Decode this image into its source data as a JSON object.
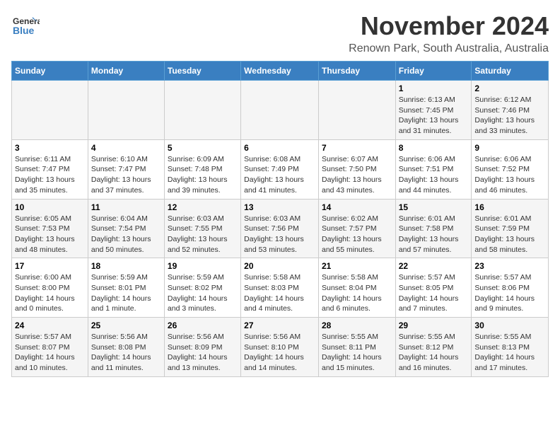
{
  "header": {
    "logo_line1": "General",
    "logo_line2": "Blue",
    "title": "November 2024",
    "subtitle": "Renown Park, South Australia, Australia"
  },
  "days_of_week": [
    "Sunday",
    "Monday",
    "Tuesday",
    "Wednesday",
    "Thursday",
    "Friday",
    "Saturday"
  ],
  "weeks": [
    [
      {
        "day": "",
        "content": ""
      },
      {
        "day": "",
        "content": ""
      },
      {
        "day": "",
        "content": ""
      },
      {
        "day": "",
        "content": ""
      },
      {
        "day": "",
        "content": ""
      },
      {
        "day": "1",
        "content": "Sunrise: 6:13 AM\nSunset: 7:45 PM\nDaylight: 13 hours and 31 minutes."
      },
      {
        "day": "2",
        "content": "Sunrise: 6:12 AM\nSunset: 7:46 PM\nDaylight: 13 hours and 33 minutes."
      }
    ],
    [
      {
        "day": "3",
        "content": "Sunrise: 6:11 AM\nSunset: 7:47 PM\nDaylight: 13 hours and 35 minutes."
      },
      {
        "day": "4",
        "content": "Sunrise: 6:10 AM\nSunset: 7:47 PM\nDaylight: 13 hours and 37 minutes."
      },
      {
        "day": "5",
        "content": "Sunrise: 6:09 AM\nSunset: 7:48 PM\nDaylight: 13 hours and 39 minutes."
      },
      {
        "day": "6",
        "content": "Sunrise: 6:08 AM\nSunset: 7:49 PM\nDaylight: 13 hours and 41 minutes."
      },
      {
        "day": "7",
        "content": "Sunrise: 6:07 AM\nSunset: 7:50 PM\nDaylight: 13 hours and 43 minutes."
      },
      {
        "day": "8",
        "content": "Sunrise: 6:06 AM\nSunset: 7:51 PM\nDaylight: 13 hours and 44 minutes."
      },
      {
        "day": "9",
        "content": "Sunrise: 6:06 AM\nSunset: 7:52 PM\nDaylight: 13 hours and 46 minutes."
      }
    ],
    [
      {
        "day": "10",
        "content": "Sunrise: 6:05 AM\nSunset: 7:53 PM\nDaylight: 13 hours and 48 minutes."
      },
      {
        "day": "11",
        "content": "Sunrise: 6:04 AM\nSunset: 7:54 PM\nDaylight: 13 hours and 50 minutes."
      },
      {
        "day": "12",
        "content": "Sunrise: 6:03 AM\nSunset: 7:55 PM\nDaylight: 13 hours and 52 minutes."
      },
      {
        "day": "13",
        "content": "Sunrise: 6:03 AM\nSunset: 7:56 PM\nDaylight: 13 hours and 53 minutes."
      },
      {
        "day": "14",
        "content": "Sunrise: 6:02 AM\nSunset: 7:57 PM\nDaylight: 13 hours and 55 minutes."
      },
      {
        "day": "15",
        "content": "Sunrise: 6:01 AM\nSunset: 7:58 PM\nDaylight: 13 hours and 57 minutes."
      },
      {
        "day": "16",
        "content": "Sunrise: 6:01 AM\nSunset: 7:59 PM\nDaylight: 13 hours and 58 minutes."
      }
    ],
    [
      {
        "day": "17",
        "content": "Sunrise: 6:00 AM\nSunset: 8:00 PM\nDaylight: 14 hours and 0 minutes."
      },
      {
        "day": "18",
        "content": "Sunrise: 5:59 AM\nSunset: 8:01 PM\nDaylight: 14 hours and 1 minute."
      },
      {
        "day": "19",
        "content": "Sunrise: 5:59 AM\nSunset: 8:02 PM\nDaylight: 14 hours and 3 minutes."
      },
      {
        "day": "20",
        "content": "Sunrise: 5:58 AM\nSunset: 8:03 PM\nDaylight: 14 hours and 4 minutes."
      },
      {
        "day": "21",
        "content": "Sunrise: 5:58 AM\nSunset: 8:04 PM\nDaylight: 14 hours and 6 minutes."
      },
      {
        "day": "22",
        "content": "Sunrise: 5:57 AM\nSunset: 8:05 PM\nDaylight: 14 hours and 7 minutes."
      },
      {
        "day": "23",
        "content": "Sunrise: 5:57 AM\nSunset: 8:06 PM\nDaylight: 14 hours and 9 minutes."
      }
    ],
    [
      {
        "day": "24",
        "content": "Sunrise: 5:57 AM\nSunset: 8:07 PM\nDaylight: 14 hours and 10 minutes."
      },
      {
        "day": "25",
        "content": "Sunrise: 5:56 AM\nSunset: 8:08 PM\nDaylight: 14 hours and 11 minutes."
      },
      {
        "day": "26",
        "content": "Sunrise: 5:56 AM\nSunset: 8:09 PM\nDaylight: 14 hours and 13 minutes."
      },
      {
        "day": "27",
        "content": "Sunrise: 5:56 AM\nSunset: 8:10 PM\nDaylight: 14 hours and 14 minutes."
      },
      {
        "day": "28",
        "content": "Sunrise: 5:55 AM\nSunset: 8:11 PM\nDaylight: 14 hours and 15 minutes."
      },
      {
        "day": "29",
        "content": "Sunrise: 5:55 AM\nSunset: 8:12 PM\nDaylight: 14 hours and 16 minutes."
      },
      {
        "day": "30",
        "content": "Sunrise: 5:55 AM\nSunset: 8:13 PM\nDaylight: 14 hours and 17 minutes."
      }
    ]
  ]
}
